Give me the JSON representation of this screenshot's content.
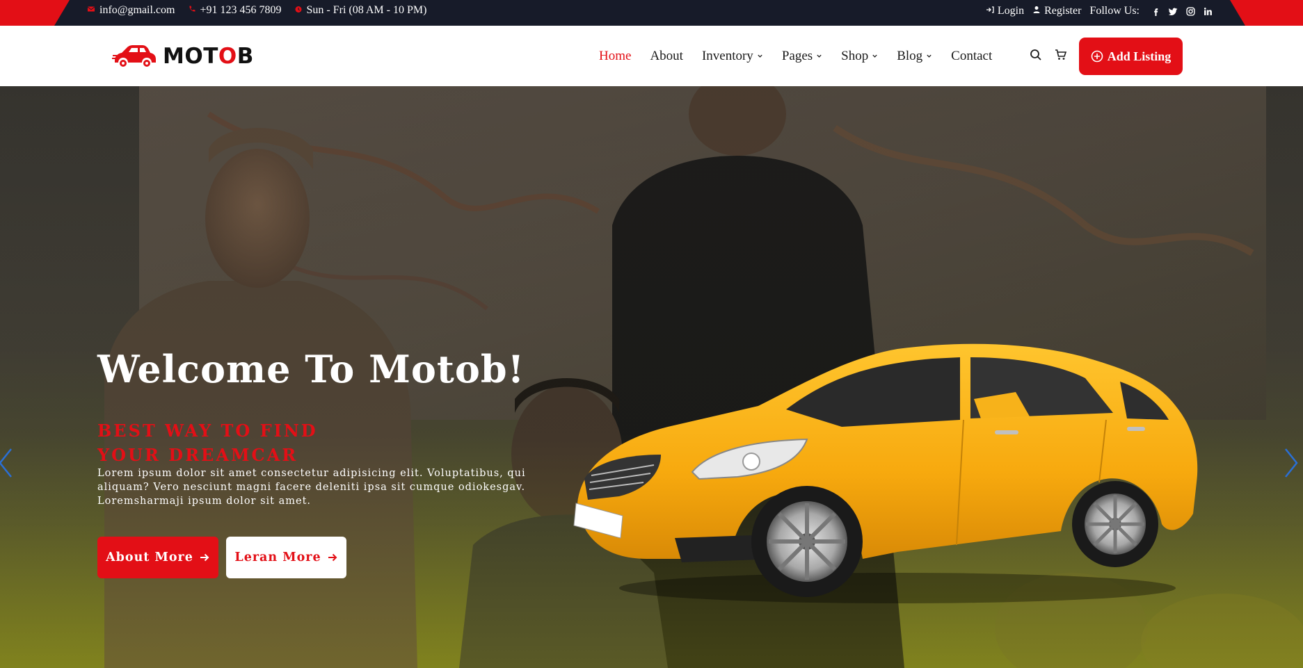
{
  "topbar": {
    "email": "info@gmail.com",
    "phone": "+91 123 456 7809",
    "hours": "Sun - Fri (08 AM - 10 PM)",
    "login": "Login",
    "register": "Register",
    "follow": "Follow Us:",
    "social_icons": [
      "facebook-icon",
      "twitter-icon",
      "instagram-icon",
      "linkedin-icon"
    ]
  },
  "header": {
    "logo_text_prefix": "MOT",
    "logo_text_o": "O",
    "logo_text_suffix": "B",
    "nav": [
      {
        "label": "Home",
        "active": true,
        "dropdown": false
      },
      {
        "label": "About",
        "active": false,
        "dropdown": false
      },
      {
        "label": "Inventory",
        "active": false,
        "dropdown": true
      },
      {
        "label": "Pages",
        "active": false,
        "dropdown": true
      },
      {
        "label": "Shop",
        "active": false,
        "dropdown": true
      },
      {
        "label": "Blog",
        "active": false,
        "dropdown": true
      },
      {
        "label": "Contact",
        "active": false,
        "dropdown": false
      }
    ],
    "add_listing": "Add Listing"
  },
  "hero": {
    "title": "Welcome To Motob!",
    "subtitle_line1": "BEST WAY TO FIND",
    "subtitle_line2": "YOUR DREAMCAR",
    "description": "Lorem ipsum dolor sit amet consectetur adipisicing elit. Voluptatibus, qui aliquam? Vero nesciunt magni facere deleniti ipsa sit cumque odiokesgav. Loremsharmaji ipsum dolor sit amet.",
    "button_primary": "About More",
    "button_secondary": "Leran More"
  },
  "colors": {
    "accent": "#e30f16",
    "topbar_dark": "#171b29",
    "car_yellow": "#f7b21a",
    "arrow_blue": "#2a6fd6"
  }
}
